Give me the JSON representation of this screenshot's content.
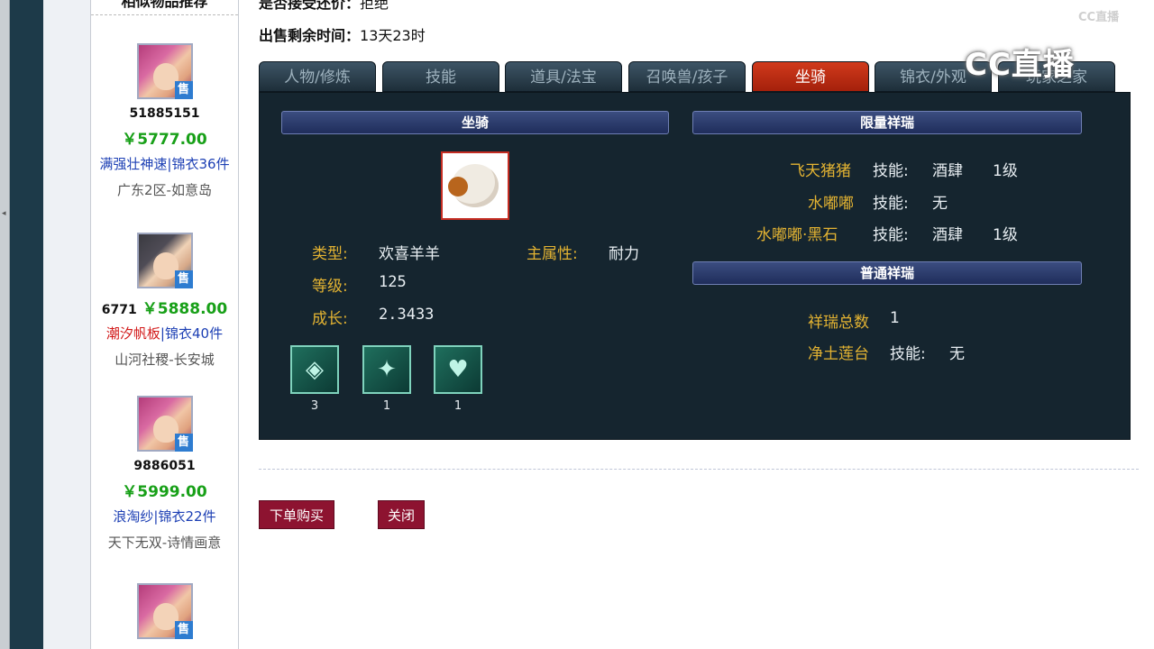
{
  "left_sidebar": {
    "title": "相似物品推荐",
    "items": [
      {
        "id": "51885151",
        "price": "￥5777.00",
        "tag1": "满强壮神速",
        "tag2": "锦衣36件",
        "server": "广东2区-如意岛"
      },
      {
        "id": "6771",
        "price": "￥5888.00",
        "tag1": "潮汐帆板",
        "tag2": "锦衣40件",
        "server": "山河社稷-长安城"
      },
      {
        "id": "9886051",
        "price": "￥5999.00",
        "tag1": "浪淘纱",
        "tag2": "锦衣22件",
        "server": "天下无双-诗情画意"
      }
    ],
    "sell_badge": "售"
  },
  "header": {
    "bargain_label": "是否接受还价：",
    "bargain_value": "拒绝",
    "remaining_label": "出售剩余时间：",
    "remaining_value": "13天23时"
  },
  "tabs": [
    "人物/修炼",
    "技能",
    "道具/法宝",
    "召唤兽/孩子",
    "坐骑",
    "锦衣/外观",
    "玩家之家"
  ],
  "active_tab": "坐骑",
  "mount": {
    "section_title": "坐骑",
    "type_label": "类型:",
    "type_value": "欢喜羊羊",
    "main_attr_label": "主属性:",
    "main_attr_value": "耐力",
    "level_label": "等级:",
    "level_value": "125",
    "growth_label": "成长:",
    "growth_value": "2.3433",
    "skills": [
      {
        "icon": "mount-skill-1-icon",
        "count": "3"
      },
      {
        "icon": "mount-skill-2-icon",
        "count": "1"
      },
      {
        "icon": "mount-skill-3-icon",
        "count": "1"
      }
    ]
  },
  "limited": {
    "section_title": "限量祥瑞",
    "rows": [
      {
        "name": "飞天猪猪",
        "skill_label": "技能:",
        "skill": "酒肆",
        "level": "1级"
      },
      {
        "name": "水嘟嘟",
        "skill_label": "技能:",
        "skill": "无",
        "level": ""
      },
      {
        "name": "水嘟嘟·黑石",
        "skill_label": "技能:",
        "skill": "酒肆",
        "level": "1级"
      }
    ]
  },
  "normal": {
    "section_title": "普通祥瑞",
    "total_label": "祥瑞总数",
    "total_value": "1",
    "rows": [
      {
        "name": "净土莲台",
        "skill_label": "技能:",
        "skill": "无"
      }
    ]
  },
  "actions": {
    "buy": "下单购买",
    "close": "关闭"
  },
  "watermark": {
    "small": "CC直播",
    "big": "CC直播"
  },
  "colors": {
    "active_tab": "#c22a12",
    "panel_bg": "#15252f",
    "label_gold": "#e3b332",
    "price_green": "#18a018",
    "button": "#8d1330"
  }
}
